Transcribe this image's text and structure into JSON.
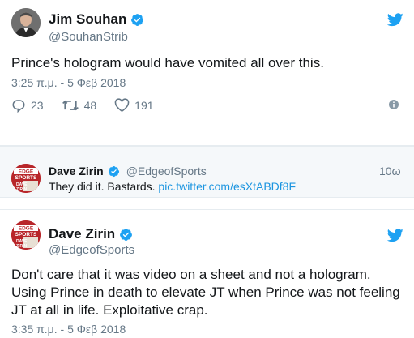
{
  "colors": {
    "twitter_blue": "#1da1f2",
    "link_blue": "#1b95e0",
    "secondary_text": "#657786",
    "primary_text": "#14171a",
    "quoted_bg": "#f5f8fa"
  },
  "tweet1": {
    "name": "Jim Souhan",
    "handle": "@SouhanStrib",
    "text": "Prince's hologram would have vomited all over this.",
    "timestamp": "3:25 π.μ. - 5 Φεβ 2018",
    "replies": "23",
    "retweets": "48",
    "likes": "191",
    "icons": [
      "verified-badge-icon",
      "twitter-bird-icon",
      "reply-icon",
      "retweet-icon",
      "like-heart-icon",
      "info-icon"
    ]
  },
  "quoted": {
    "name": "Dave Zirin",
    "handle": "@EdgeofSports",
    "time": "10ω",
    "text": "They did it. Bastards.",
    "link": "pic.twitter.com/esXtABDf8F",
    "avatar_text": [
      "EDGE",
      "SPORTS",
      "DAVE",
      "ZIRIN"
    ]
  },
  "tweet2": {
    "name": "Dave Zirin",
    "handle": "@EdgeofSports",
    "text": "Don't care that it was video on a sheet and not a hologram. Using Prince in death to elevate JT when Prince was not feeling JT at all in life. Exploitative crap.",
    "timestamp": "3:35 π.μ. - 5 Φεβ 2018",
    "avatar_text": [
      "EDGE",
      "SPORTS",
      "DAVE",
      "ZIRIN"
    ]
  }
}
